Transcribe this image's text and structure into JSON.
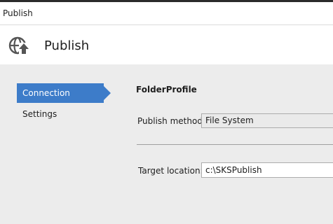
{
  "window": {
    "title": "Publish"
  },
  "header": {
    "title": "Publish",
    "icon": "globe-publish-icon"
  },
  "sidebar": {
    "items": [
      {
        "label": "Connection",
        "active": true
      },
      {
        "label": "Settings",
        "active": false
      }
    ]
  },
  "connection": {
    "profile_name": "FolderProfile",
    "publish_method_label": "Publish method:",
    "publish_method_value": "File System",
    "target_location_label": "Target location:",
    "target_location_value": "c:\\SKSPublish"
  },
  "colors": {
    "accent": "#3d7cc9",
    "background": "#ececec",
    "header_bg": "#ffffff"
  }
}
